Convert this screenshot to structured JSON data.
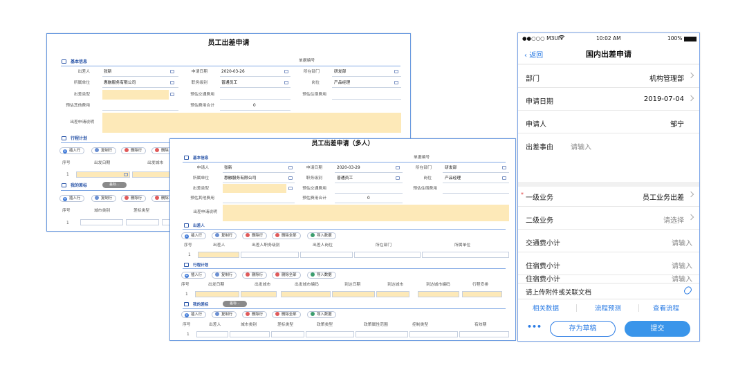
{
  "p1": {
    "title": "员工出差申请",
    "basic": "基本信息",
    "fields": {
      "applicant_l": "出差人",
      "applicant": "张新",
      "date_l": "申请日期",
      "date": "2020-03-26",
      "doc_l": "单据编号",
      "dept_l": "所在部门",
      "dept": "研发部",
      "unit_l": "所属单位",
      "unit": "惠融服务有限公司",
      "rank_l": "职务级别",
      "rank": "普通员工",
      "post_l": "岗位",
      "post": "产品经理",
      "type_l": "出差类型",
      "traffic_l": "预估交通费用",
      "hotel_l": "预估住宿费用",
      "other_l": "预估其他费用",
      "total_l": "预估费用合计",
      "total": "0",
      "desc_l": "出差申请说明"
    },
    "trip": "行程计划",
    "btn": {
      "add": "插入行",
      "copy": "复制行",
      "del": "删除行",
      "del2": "删除"
    },
    "trip_cols": {
      "no": "序号",
      "start": "出发日期",
      "city": "出发城市"
    },
    "row1": "1",
    "target": "我的差标",
    "chip": "差标...",
    "target_cols": {
      "no": "序号",
      "ctype": "城市类别",
      "ttype": "差标类型"
    }
  },
  "p2": {
    "title": "员工出差申请（多人）",
    "basic": "基本信息",
    "fields": {
      "applicant_l": "申请人",
      "applicant": "张新",
      "date_l": "申请日期",
      "date": "2020-03-29",
      "doc_l": "单据编号",
      "dept_l": "所在部门",
      "dept": "研发部",
      "unit_l": "所属单位",
      "unit": "惠融服务有限公司",
      "rank_l": "职务级别",
      "rank": "普通员工",
      "post_l": "岗位",
      "post": "产品经理",
      "type_l": "出差类型",
      "traffic_l": "预估交通费用",
      "hotel_l": "预估住宿费用",
      "other_l": "预估其他费用",
      "total_l": "预估费用合计",
      "total": "0",
      "desc_l": "出差申请说明"
    },
    "traveler": "出差人",
    "trip": "行程计划",
    "target": "我的差标",
    "chip": "差标...",
    "btn": {
      "add": "插入行",
      "copy": "复制行",
      "del": "删除行",
      "delall": "删除全部",
      "imp": "导入数据"
    },
    "trav_cols": [
      "序号",
      "出差人",
      "出差人职务级别",
      "出差人岗位",
      "所在部门",
      "所属单位"
    ],
    "trip_cols": [
      "序号",
      "出发日期",
      "出发城市",
      "出发城市编码",
      "到达日期",
      "到达城市",
      "到达城市编码",
      "行程安排"
    ],
    "tgt_cols": [
      "序号",
      "出差人",
      "城市类别",
      "差标类型",
      "政策类型",
      "政策属性范围",
      "控制类型",
      "有效期"
    ],
    "row1": "1"
  },
  "p3": {
    "status": {
      "carrier": "●●○○○ M3UI",
      "time": "10:02 AM",
      "battery": "100%"
    },
    "back": "返回",
    "title": "国内出差申请",
    "rows": {
      "dept_l": "部门",
      "dept": "机构管理部",
      "date_l": "申请日期",
      "date": "2019-07-04",
      "applicant_l": "申请人",
      "applicant": "邹宁",
      "reason_l": "出差事由",
      "reason_ph": "请输入",
      "biz1_l": "一级业务",
      "biz1": "员工业务出差",
      "biz2_l": "二级业务",
      "biz2_ph": "请选择",
      "traffic_l": "交通费小计",
      "traffic_ph": "请输入",
      "hotel_l": "住宿费小计",
      "hotel_ph": "请输入",
      "cut_l": "住宿费小计",
      "cut_v": "请输入"
    },
    "attach": "请上传附件或关联文档",
    "links": [
      "相关数据",
      "流程预测",
      "查看流程"
    ],
    "more": "•••",
    "draft": "存为草稿",
    "submit": "提交",
    "accent": "#2a7be4"
  }
}
